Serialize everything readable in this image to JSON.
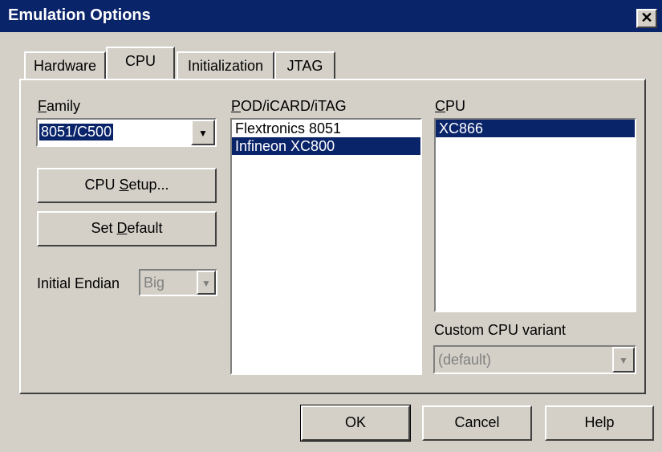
{
  "window": {
    "title": "Emulation Options",
    "close_glyph": "✕"
  },
  "tabs": [
    {
      "label": "Hardware",
      "active": false
    },
    {
      "label": "CPU",
      "active": true
    },
    {
      "label": "Initialization",
      "active": false
    },
    {
      "label": "JTAG",
      "active": false
    }
  ],
  "family": {
    "label_mnemonic": "F",
    "label_rest": "amily",
    "selected": "8051/C500"
  },
  "buttons": {
    "cpu_setup_pre": "CPU ",
    "cpu_setup_mn": "S",
    "cpu_setup_post": "etup...",
    "set_default_pre": "Set ",
    "set_default_mn": "D",
    "set_default_post": "efault"
  },
  "initial_endian": {
    "label": "Initial Endian",
    "value": "Big"
  },
  "pod": {
    "label_mnemonic": "P",
    "label_rest": "OD/iCARD/iTAG",
    "items": [
      "Flextronics 8051",
      "Infineon XC800"
    ],
    "selected_index": 1
  },
  "cpu": {
    "label_mnemonic": "C",
    "label_rest": "PU",
    "items": [
      "XC866"
    ],
    "selected_index": 0
  },
  "custom_variant": {
    "label": "Custom CPU variant",
    "value": "(default)"
  },
  "footer": {
    "ok": "OK",
    "cancel": "Cancel",
    "help": "Help"
  },
  "colors": {
    "face": "#d4d0c8",
    "titlebar": "#0a246a",
    "selection": "#0a246a"
  }
}
